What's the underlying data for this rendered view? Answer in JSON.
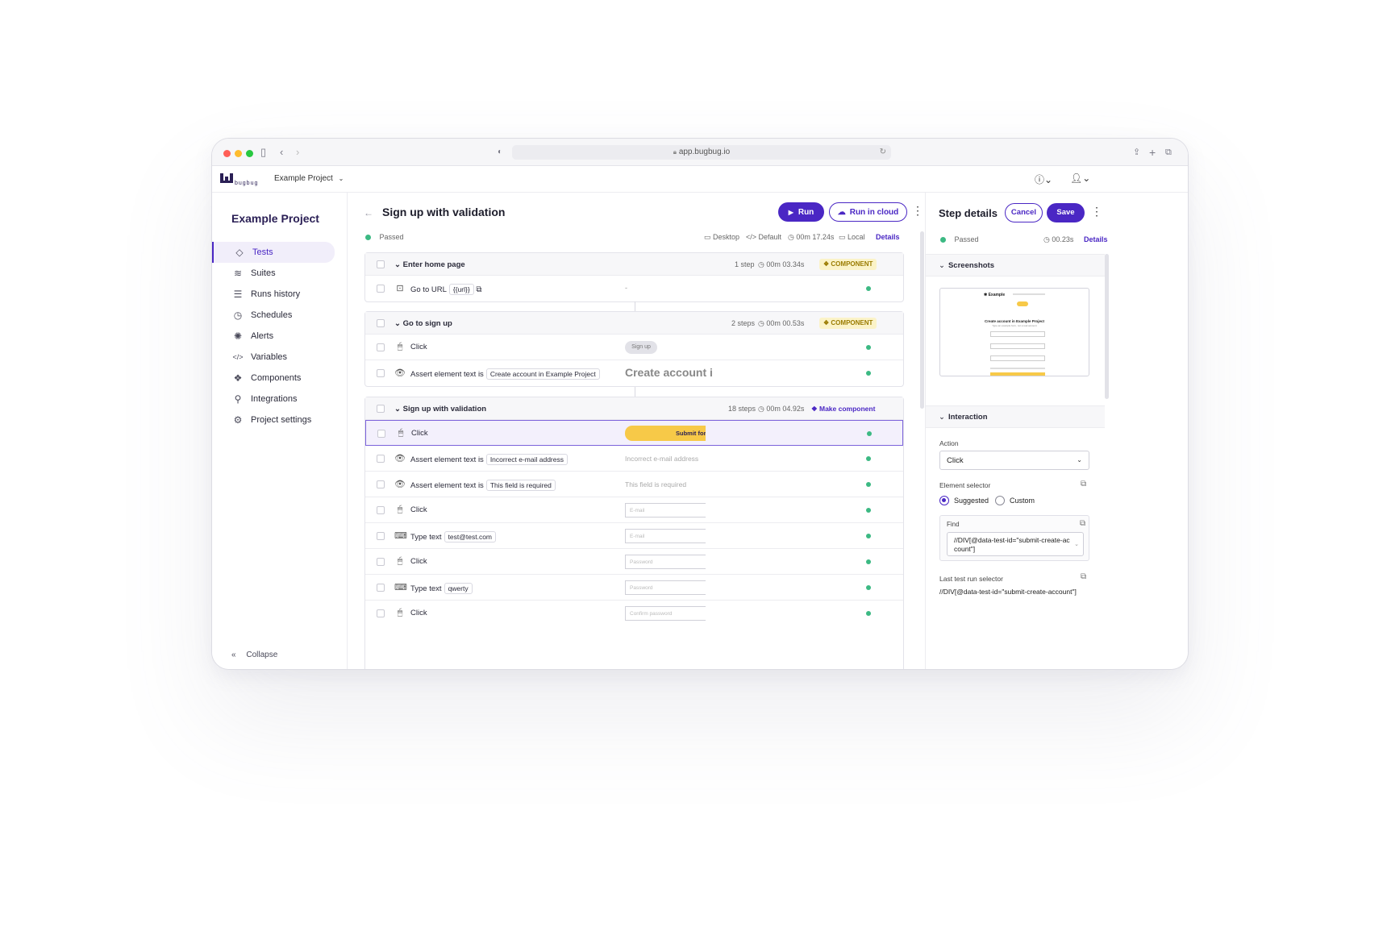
{
  "browser": {
    "url": "app.bugbug.io"
  },
  "app": {
    "logo_text": "bugbug",
    "project_switcher": "Example Project"
  },
  "sidebar": {
    "title": "Example Project",
    "items": [
      {
        "label": "Tests",
        "icon": "diamond-icon"
      },
      {
        "label": "Suites",
        "icon": "layers-icon"
      },
      {
        "label": "Runs history",
        "icon": "list-icon"
      },
      {
        "label": "Schedules",
        "icon": "clock-icon"
      },
      {
        "label": "Alerts",
        "icon": "bell-icon"
      },
      {
        "label": "Variables",
        "icon": "code-icon"
      },
      {
        "label": "Components",
        "icon": "components-icon"
      },
      {
        "label": "Integrations",
        "icon": "integrations-icon"
      },
      {
        "label": "Project settings",
        "icon": "gear-icon"
      }
    ],
    "collapse_label": "Collapse"
  },
  "test": {
    "title": "Sign up with validation",
    "run_label": "Run",
    "run_cloud_label": "Run in cloud",
    "status": "Passed",
    "device": "Desktop",
    "profile": "Default",
    "duration": "00m 17.24s",
    "location": "Local",
    "details_label": "Details"
  },
  "groups": [
    {
      "name": "Enter home page",
      "steps_count": "1 step",
      "duration": "00m 03.34s",
      "badge": "COMPONENT",
      "steps": [
        {
          "label": "Go to URL",
          "chip": "{{url}}",
          "preview": "-"
        }
      ]
    },
    {
      "name": "Go to sign up",
      "steps_count": "2 steps",
      "duration": "00m 00.53s",
      "badge": "COMPONENT",
      "steps": [
        {
          "label": "Click",
          "chip": "",
          "preview": "Sign up"
        },
        {
          "label": "Assert element text is",
          "chip": "Create account in Example Project",
          "preview": "Create account i"
        }
      ]
    },
    {
      "name": "Sign up with validation",
      "steps_count": "18 steps",
      "duration": "00m 04.92s",
      "badge": "Make component",
      "steps": [
        {
          "label": "Click",
          "chip": "",
          "preview": "Submit form"
        },
        {
          "label": "Assert element text is",
          "chip": "Incorrect e-mail address",
          "preview": "Incorrect e-mail address"
        },
        {
          "label": "Assert element text is",
          "chip": "This field is required",
          "preview": "This field is required"
        },
        {
          "label": "Click",
          "chip": "",
          "preview": "E-mail"
        },
        {
          "label": "Type text",
          "chip": "test@test.com",
          "preview": "E-mail"
        },
        {
          "label": "Click",
          "chip": "",
          "preview": "Password"
        },
        {
          "label": "Type text",
          "chip": "qwerty",
          "preview": "Password"
        },
        {
          "label": "Click",
          "chip": "",
          "preview": "Confirm password"
        }
      ]
    }
  ],
  "step_details": {
    "title": "Step details",
    "cancel_label": "Cancel",
    "save_label": "Save",
    "status": "Passed",
    "duration": "00.23s",
    "details_label": "Details",
    "screenshots_label": "Screenshots",
    "screenshot": {
      "brand": "Example",
      "heading": "Create account in Example Project",
      "subheading": "Type an example form, not a real account"
    },
    "interaction_label": "Interaction",
    "action_label": "Action",
    "action_value": "Click",
    "element_selector_label": "Element selector",
    "suggested_label": "Suggested",
    "custom_label": "Custom",
    "find_label": "Find",
    "find_value": "//DIV[@data-test-id=\"submit-create-account\"]",
    "last_run_label": "Last test run selector",
    "last_run_value": "//DIV[@data-test-id=\"submit-create-account\"]"
  },
  "colors": {
    "accent": "#4a27c4",
    "success": "#3cb983",
    "highlight": "#f7c948"
  }
}
